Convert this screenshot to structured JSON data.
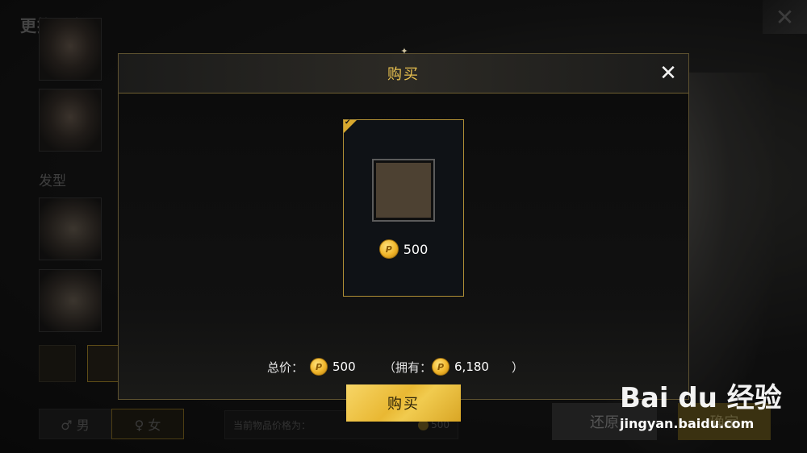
{
  "screen": {
    "title": "更换形象",
    "close_glyph": "✕",
    "hair_label": "发型",
    "gender": {
      "male_label": "♂ 男",
      "female_label": "♀ 女",
      "selected": "female"
    },
    "price_bar": {
      "label": "当前物品价格为：",
      "value": "500"
    },
    "restore_label": "还原",
    "confirm_label": "确定"
  },
  "dialog": {
    "title": "购买",
    "close_glyph": "✕",
    "ornament": "✦",
    "item": {
      "price": "500",
      "check": "✔",
      "swatch_color": "#4d4132"
    },
    "total_label": "总价：",
    "total_value": "500",
    "owned_open": "（拥有：",
    "owned_value": "6,180",
    "owned_close": "）",
    "buy_label": "购买",
    "coin_glyph": "P"
  },
  "colors": {
    "accent_gold": "#e8c04f",
    "button_gold": "#e9b833",
    "frame_gold": "#b08f35"
  },
  "watermark": {
    "logo": "Bai du 经验",
    "url": "jingyan.baidu.com"
  }
}
